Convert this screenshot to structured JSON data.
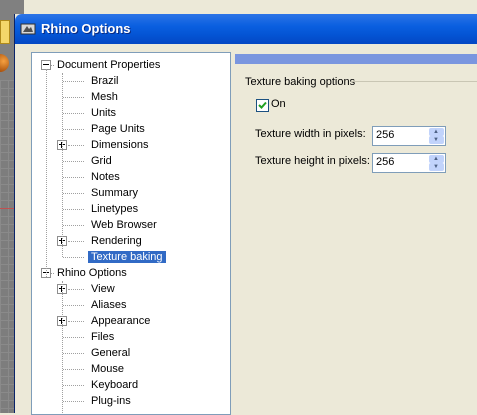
{
  "window": {
    "title": "Rhino Options"
  },
  "tree": {
    "items": [
      {
        "label": "Document Properties",
        "expander": "minus",
        "selected": false
      },
      {
        "label": "Brazil",
        "expander": "",
        "selected": false
      },
      {
        "label": "Mesh",
        "expander": "",
        "selected": false
      },
      {
        "label": "Units",
        "expander": "",
        "selected": false
      },
      {
        "label": "Page Units",
        "expander": "",
        "selected": false
      },
      {
        "label": "Dimensions",
        "expander": "plus",
        "selected": false
      },
      {
        "label": "Grid",
        "expander": "",
        "selected": false
      },
      {
        "label": "Notes",
        "expander": "",
        "selected": false
      },
      {
        "label": "Summary",
        "expander": "",
        "selected": false
      },
      {
        "label": "Linetypes",
        "expander": "",
        "selected": false
      },
      {
        "label": "Web Browser",
        "expander": "",
        "selected": false
      },
      {
        "label": "Rendering",
        "expander": "plus",
        "selected": false
      },
      {
        "label": "Texture baking",
        "expander": "",
        "selected": true
      },
      {
        "label": "Rhino Options",
        "expander": "minus",
        "selected": false
      },
      {
        "label": "View",
        "expander": "plus",
        "selected": false
      },
      {
        "label": "Aliases",
        "expander": "",
        "selected": false
      },
      {
        "label": "Appearance",
        "expander": "plus",
        "selected": false
      },
      {
        "label": "Files",
        "expander": "",
        "selected": false
      },
      {
        "label": "General",
        "expander": "",
        "selected": false
      },
      {
        "label": "Mouse",
        "expander": "",
        "selected": false
      },
      {
        "label": "Keyboard",
        "expander": "",
        "selected": false
      },
      {
        "label": "Plug-ins",
        "expander": "",
        "selected": false
      }
    ]
  },
  "panel": {
    "group_title": "Texture baking options",
    "on_label": "On",
    "on_checked": true,
    "width_label": "Texture width in pixels:",
    "width_value": "256",
    "height_label": "Texture height in pixels:",
    "height_value": "256"
  },
  "colors": {
    "title_bar": "#0A5FE0",
    "selection": "#316AC5",
    "banner": "#7A96DF"
  }
}
